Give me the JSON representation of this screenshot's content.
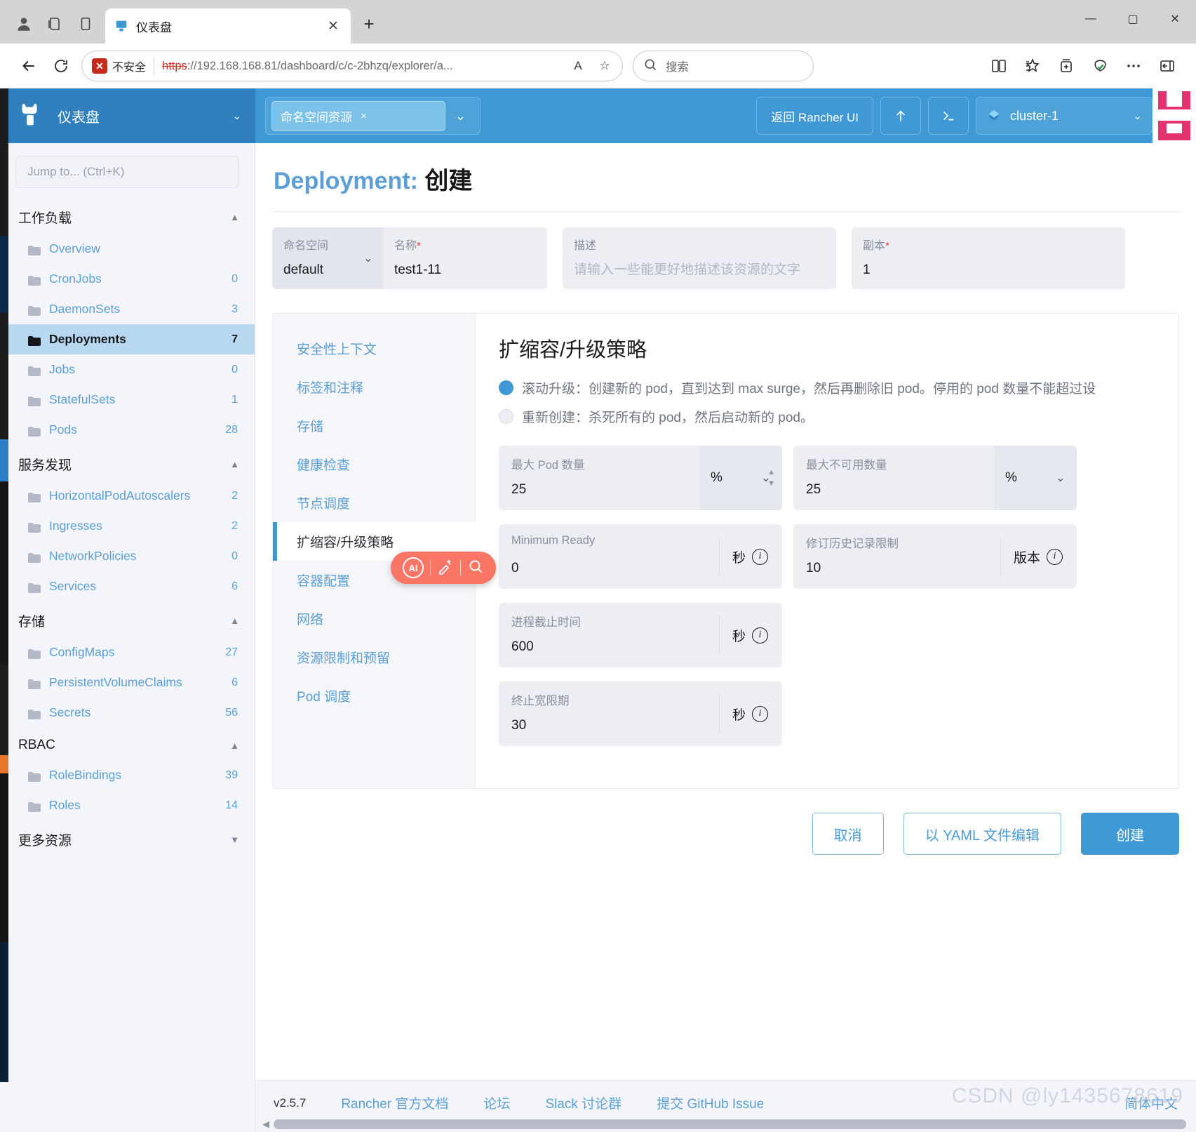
{
  "browser": {
    "tab": {
      "title": "仪表盘",
      "favicon_name": "rancher-favicon",
      "close_label": "✕"
    },
    "newtab_label": "+",
    "window_controls": {
      "minimize": "—",
      "maximize": "▢",
      "close": "✕"
    },
    "nav": {
      "back": "←",
      "reload": "⟳"
    },
    "omnibox": {
      "security_label": "不安全",
      "security_icon_text": "✕",
      "url_scheme": "https",
      "url_rest": "://192.168.168.81/dashboard/c/c-2bhzq/explorer/a...",
      "url_host": "192.168.168.81",
      "url_path": "/dashboard/c/c-2bhzq/explorer/a...",
      "read_aloud_icon": "A",
      "favorite_icon": "☆"
    },
    "search": {
      "placeholder": "搜索",
      "icon": "search-icon"
    },
    "toolbar_icons": [
      "split-screen-icon",
      "favorites-icon",
      "collections-icon",
      "browser-essentials-icon",
      "more-icon",
      "sidebar-icon"
    ]
  },
  "header": {
    "brand": "仪表盘",
    "namespace_filter": {
      "label": "命名空间资源",
      "clear": "×"
    },
    "back_to_rancher": "返回 Rancher UI",
    "import_icon": "import-yaml-icon",
    "shell_icon": "kubectl-shell-icon",
    "cluster": "cluster-1"
  },
  "sidebar": {
    "jump_placeholder": "Jump to... (Ctrl+K)",
    "groups": [
      {
        "title": "工作负载",
        "items": [
          {
            "label": "Overview",
            "count": ""
          },
          {
            "label": "CronJobs",
            "count": "0"
          },
          {
            "label": "DaemonSets",
            "count": "3"
          },
          {
            "label": "Deployments",
            "count": "7",
            "active": true
          },
          {
            "label": "Jobs",
            "count": "0"
          },
          {
            "label": "StatefulSets",
            "count": "1"
          },
          {
            "label": "Pods",
            "count": "28"
          }
        ]
      },
      {
        "title": "服务发现",
        "items": [
          {
            "label": "HorizontalPodAutoscalers",
            "count": "2"
          },
          {
            "label": "Ingresses",
            "count": "2"
          },
          {
            "label": "NetworkPolicies",
            "count": "0"
          },
          {
            "label": "Services",
            "count": "6"
          }
        ]
      },
      {
        "title": "存储",
        "items": [
          {
            "label": "ConfigMaps",
            "count": "27"
          },
          {
            "label": "PersistentVolumeClaims",
            "count": "6"
          },
          {
            "label": "Secrets",
            "count": "56"
          }
        ]
      },
      {
        "title": "RBAC",
        "items": [
          {
            "label": "RoleBindings",
            "count": "39"
          },
          {
            "label": "Roles",
            "count": "14"
          }
        ]
      },
      {
        "title": "更多资源",
        "collapsed": true,
        "items": []
      }
    ]
  },
  "page": {
    "title_prefix": "Deployment:",
    "title_suffix": "创建",
    "fields": {
      "namespace": {
        "label": "命名空间",
        "value": "default"
      },
      "name": {
        "label": "名称",
        "required": "*",
        "value": "test1-11"
      },
      "description": {
        "label": "描述",
        "placeholder": "请输入一些能更好地描述该资源的文字"
      },
      "replicas": {
        "label": "副本",
        "required": "*",
        "value": "1"
      }
    },
    "tabs": [
      {
        "label": "安全性上下文"
      },
      {
        "label": "标签和注释"
      },
      {
        "label": "存储"
      },
      {
        "label": "健康检查"
      },
      {
        "label": "节点调度"
      },
      {
        "label": "扩缩容/升级策略",
        "active": true
      },
      {
        "label": "容器配置"
      },
      {
        "label": "网络"
      },
      {
        "label": "资源限制和预留"
      },
      {
        "label": "Pod 调度"
      }
    ],
    "panel": {
      "heading": "扩缩容/升级策略",
      "radios": [
        {
          "selected": true,
          "text": "滚动升级：创建新的 pod，直到达到 max surge，然后再删除旧 pod。停用的 pod 数量不能超过设"
        },
        {
          "selected": false,
          "text": "重新创建：杀死所有的 pod，然后启动新的 pod。"
        }
      ],
      "inputs": [
        {
          "label": "最大 Pod 数量",
          "value": "25",
          "suffix": "%",
          "suffix_type": "select",
          "spinner": true
        },
        {
          "label": "最大不可用数量",
          "value": "25",
          "suffix": "%",
          "suffix_type": "select"
        },
        {
          "label": "Minimum Ready",
          "value": "0",
          "suffix": "秒",
          "suffix_type": "info"
        },
        {
          "label": "修订历史记录限制",
          "value": "10",
          "suffix": "版本",
          "suffix_type": "info"
        },
        {
          "label": "进程截止时间",
          "value": "600",
          "suffix": "秒",
          "suffix_type": "info"
        },
        {
          "label": "终止宽限期",
          "value": "30",
          "suffix": "秒",
          "suffix_type": "info"
        }
      ]
    },
    "actions": {
      "cancel": "取消",
      "yaml": "以 YAML 文件编辑",
      "create": "创建"
    }
  },
  "footer": {
    "version": "v2.5.7",
    "links": [
      "Rancher 官方文档",
      "论坛",
      "Slack 讨论群",
      "提交 GitHub Issue"
    ],
    "language": "简体中文"
  },
  "ai_toolbar": {
    "badge": "AI",
    "pen_icon": "magic-pen-icon",
    "search_icon": "search-icon"
  },
  "watermark": "CSDN @ly1435678619",
  "colors": {
    "rancher_blue": "#3d98d3",
    "link_blue": "#5b9fd4",
    "active_nav": "#b7d8ef",
    "field_bg": "#eceef4",
    "ai_coral": "#f97666"
  }
}
